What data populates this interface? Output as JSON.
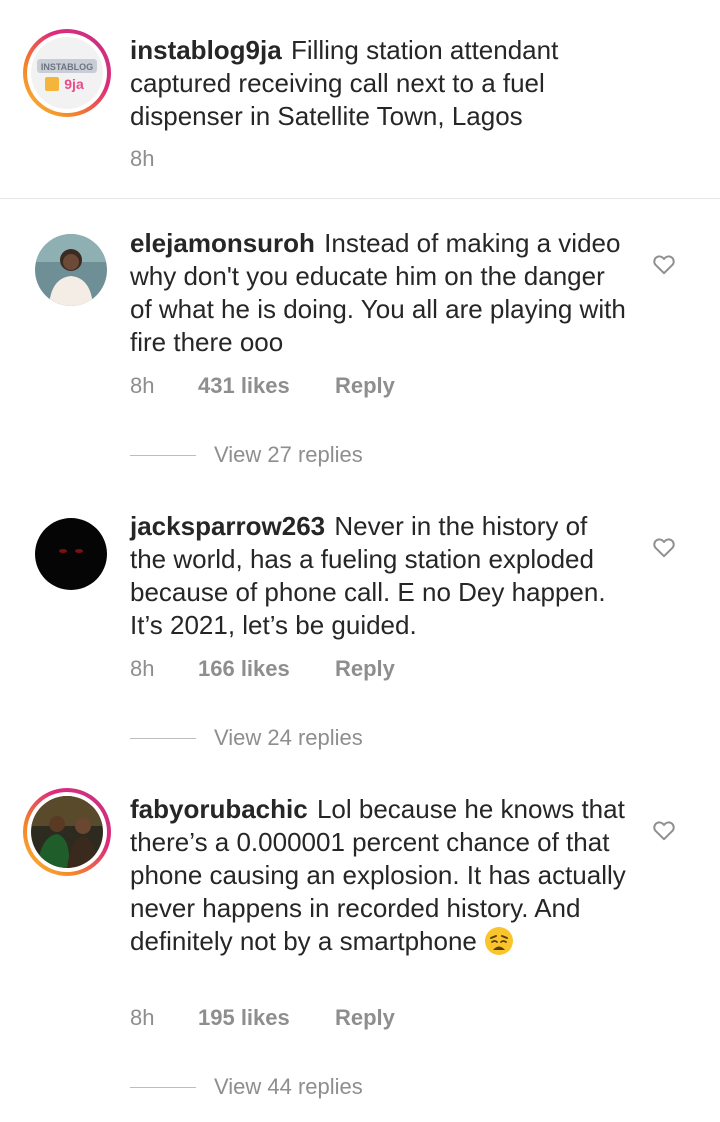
{
  "caption": {
    "username": "instablog9ja",
    "text": "Filling station attendant captured receiving call next to a fuel dispenser in Satellite Town, Lagos",
    "time": "8h",
    "avatar_logo_text": "INSTABLOG 9ja"
  },
  "comments": [
    {
      "username": "elejamonsuroh",
      "text": "Instead of making a video why don't you educate him on the danger of what he is doing. You all are playing with fire there ooo",
      "time": "8h",
      "likes": "431 likes",
      "reply_label": "Reply",
      "view_replies": "View 27 replies"
    },
    {
      "username": "jacksparrow263",
      "text": "Never in the history of the world, has a fueling station exploded because of phone call. E no Dey happen. It’s 2021, let’s be guided.",
      "time": "8h",
      "likes": "166 likes",
      "reply_label": "Reply",
      "view_replies": "View 24 replies"
    },
    {
      "username": "fabyorubachic",
      "text": "Lol because he knows that there’s a 0.000001 percent chance of that phone causing an explosion. It has actually never happens in recorded history. And definitely not by a smartphone",
      "time": "8h",
      "likes": "195 likes",
      "reply_label": "Reply",
      "view_replies": "View 44 replies"
    }
  ],
  "icons": {
    "like": "heart-outline-icon",
    "emoji": "weary-face-emoji"
  },
  "colors": {
    "text": "#262626",
    "secondary": "#8e8e8e",
    "story_ring_start": "#f9c23c",
    "story_ring_end": "#c13584"
  }
}
